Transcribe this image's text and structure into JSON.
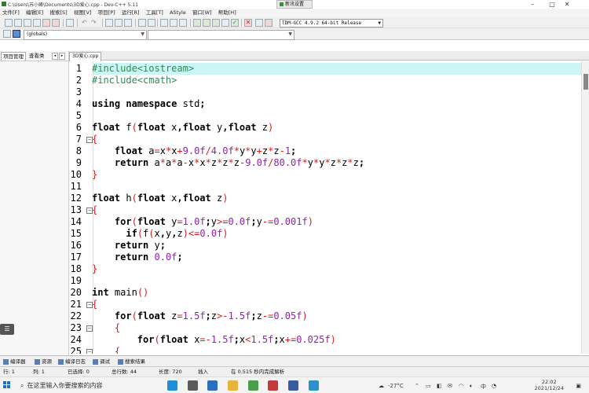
{
  "window": {
    "title": "C:\\Users\\苏小峰\\Documents\\3D爱心.cpp - Dev-C++ 5.11"
  },
  "toast": {
    "label": "新讯设置"
  },
  "menu": [
    "文件[F]",
    "编辑[E]",
    "搜索[S]",
    "视图[V]",
    "项目[P]",
    "运行[R]",
    "工具[T]",
    "AStyle",
    "窗口[W]",
    "帮助[H]"
  ],
  "compiler": {
    "selected": "TDM-GCC 4.9.2 64-bit Release"
  },
  "scope_combo": {
    "value": "(globals)"
  },
  "left_panel": {
    "tabs": [
      "项目管理",
      "查看类"
    ],
    "nav_prev": "◂",
    "nav_next": "▸"
  },
  "editor": {
    "tab_label": "3D爱心.cpp",
    "line_numbers": [
      "1",
      "2",
      "3",
      "4",
      "5",
      "6",
      "7",
      "8",
      "9",
      "10",
      "11",
      "12",
      "13",
      "14",
      "15",
      "16",
      "17",
      "18",
      "19",
      "20",
      "21",
      "22",
      "23",
      "24",
      "25"
    ],
    "code_lines": [
      "#include<iostream>",
      "#include<cmath>",
      "",
      "using namespace std;",
      "",
      "float f(float x,float y,float z)",
      "{",
      "    float a=x*x+9.0f/4.0f*y*y+z*z-1;",
      "    return a*a*a-x*x*z*z*z-9.0f/80.0f*y*y*z*z*z;",
      "}",
      "",
      "float h(float x,float z)",
      "{",
      "    for(float y=1.0f;y>=0.0f;y-=0.001f)",
      "      if(f(x,y,z)<=0.0f)",
      "    return y;",
      "    return 0.0f;",
      "}",
      "",
      "int main()",
      "{",
      "    for(float z=1.5f;z>-1.5f;z-=0.05f)",
      "    {",
      "        for(float x=-1.5f;x<1.5f;x+=0.025f)",
      "    {"
    ]
  },
  "bottom_tabs": [
    "编译器",
    "资源",
    "编译日志",
    "调试",
    "搜索结果"
  ],
  "status": {
    "row_label": "行:",
    "row": "1",
    "col_label": "列:",
    "col": "1",
    "selected_label": "已选择:",
    "selected": "0",
    "total_label": "总行数:",
    "total": "44",
    "length_label": "长度:",
    "length": "720",
    "mode": "插入",
    "parse_msg": "在 0.515 秒内完成解析"
  },
  "taskbar": {
    "search_placeholder": "在这里输入你要搜索的内容",
    "weather": "-27°C",
    "ime": "中",
    "time": "22:02",
    "date": "2021/12/24"
  },
  "colors": {
    "line_highlight": "#ccf5f6",
    "keyword": "#000000",
    "preprocessor": "#2e8b57",
    "number": "#8e24aa",
    "operator": "#d81b1b"
  }
}
